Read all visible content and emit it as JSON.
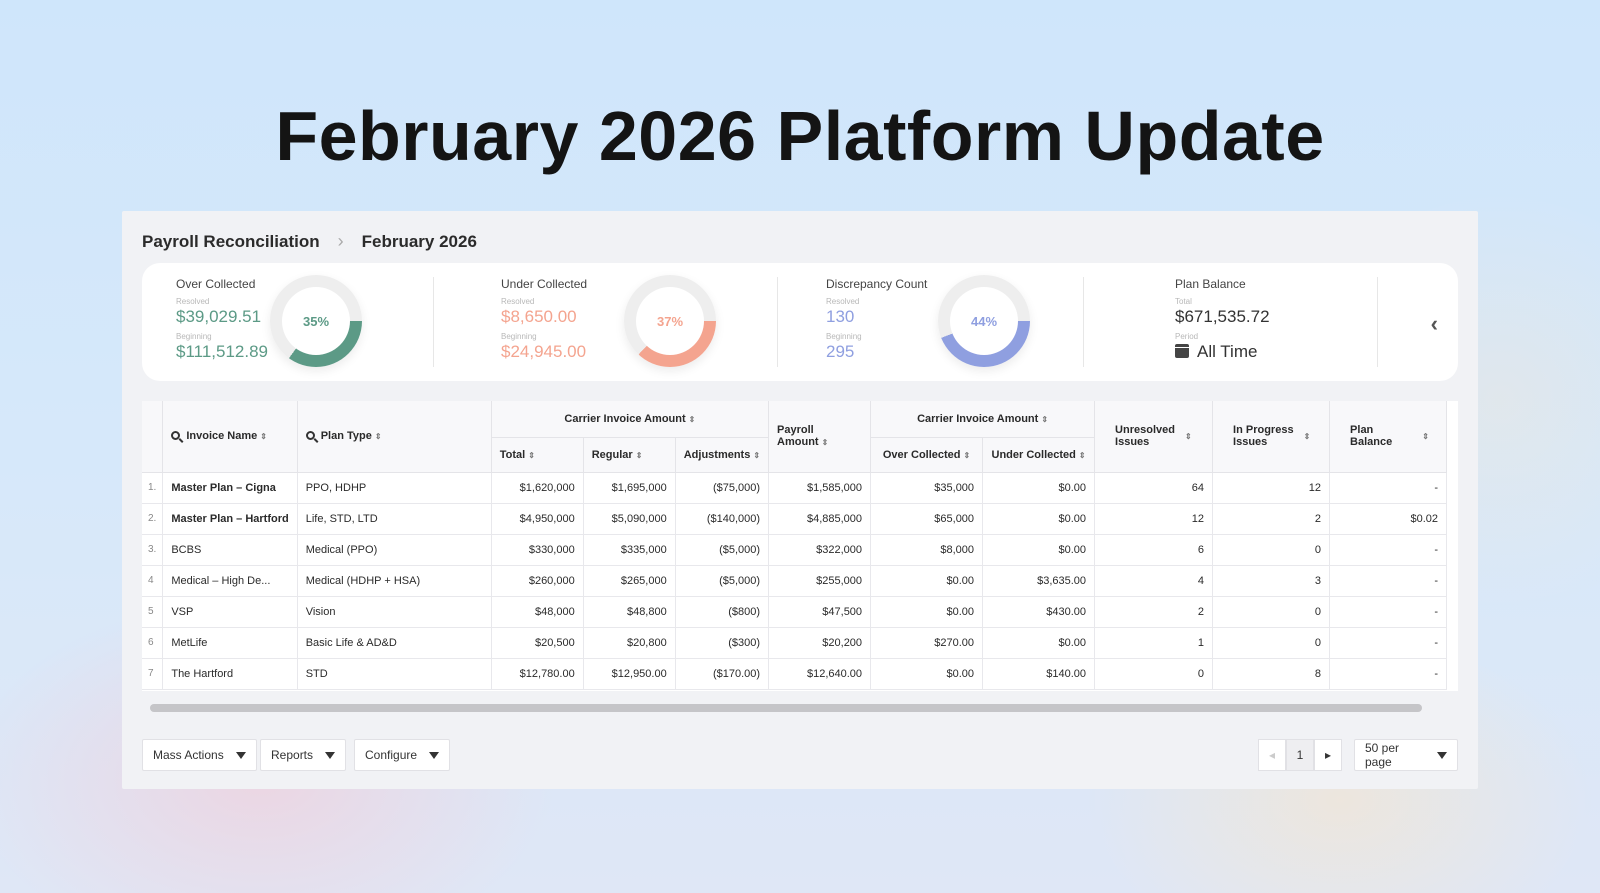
{
  "headline": "February 2026 Platform Update",
  "breadcrumb": {
    "root": "Payroll Reconciliation",
    "current": "February 2026"
  },
  "stats": [
    {
      "label": "Over Collected",
      "sub1": "Resolved",
      "val1": "$39,029.51",
      "sub2": "Beginning",
      "val2": "$111,512.89",
      "percent_text": "35%",
      "percent": 35,
      "color": "#5c9a86"
    },
    {
      "label": "Under Collected",
      "sub1": "Resolved",
      "val1": "$8,650.00",
      "sub2": "Beginning",
      "val2": "$24,945.00",
      "percent_text": "37%",
      "percent": 37,
      "color": "#f4a48f"
    },
    {
      "label": "Discrepancy Count",
      "sub1": "Resolved",
      "val1": "130",
      "sub2": "Beginning",
      "val2": "295",
      "percent_text": "44%",
      "percent": 44,
      "color": "#8f9fe0"
    },
    {
      "label": "Plan Balance",
      "sub1": "Total",
      "val1": "$671,535.72",
      "sub2": "Period",
      "val2": "All Time"
    }
  ],
  "table": {
    "headers": {
      "invoice_name": "Invoice Name",
      "plan_type": "Plan Type",
      "carrier_group": "Carrier Invoice Amount",
      "total": "Total",
      "regular": "Regular",
      "adjustments": "Adjustments",
      "payroll_amount": "Payroll Amount",
      "carrier_group2": "Carrier Invoice Amount",
      "over_collected": "Over Collected",
      "under_collected": "Under Collected",
      "unresolved_l1": "Unresolved",
      "unresolved_l2": "Issues",
      "inprogress_l1": "In Progress",
      "inprogress_l2": "Issues",
      "balance_l1": "Plan",
      "balance_l2": "Balance"
    },
    "rows": [
      {
        "idx": "1.",
        "name": "Master Plan – Cigna",
        "bold": true,
        "plan": "PPO, HDHP",
        "total": "$1,620,000",
        "regular": "$1,695,000",
        "adj": "($75,000)",
        "payroll": "$1,585,000",
        "over": "$35,000",
        "under": "$0.00",
        "unresolved": "64",
        "inprogress": "12",
        "balance": "-"
      },
      {
        "idx": "2.",
        "name": "Master Plan – Hartford",
        "bold": true,
        "plan": "Life, STD, LTD",
        "total": "$4,950,000",
        "regular": "$5,090,000",
        "adj": "($140,000)",
        "payroll": "$4,885,000",
        "over": "$65,000",
        "under": "$0.00",
        "unresolved": "12",
        "inprogress": "2",
        "balance": "$0.02"
      },
      {
        "idx": "3.",
        "name": "BCBS",
        "bold": false,
        "plan": "Medical (PPO)",
        "total": "$330,000",
        "regular": "$335,000",
        "adj": "($5,000)",
        "payroll": "$322,000",
        "over": "$8,000",
        "under": "$0.00",
        "unresolved": "6",
        "inprogress": "0",
        "balance": "-"
      },
      {
        "idx": "4",
        "name": "Medical – High De...",
        "bold": false,
        "plan": "Medical (HDHP + HSA)",
        "total": "$260,000",
        "regular": "$265,000",
        "adj": "($5,000)",
        "payroll": "$255,000",
        "over": "$0.00",
        "under": "$3,635.00",
        "unresolved": "4",
        "inprogress": "3",
        "balance": "-"
      },
      {
        "idx": "5",
        "name": "VSP",
        "bold": false,
        "plan": "Vision",
        "total": "$48,000",
        "regular": "$48,800",
        "adj": "($800)",
        "payroll": "$47,500",
        "over": "$0.00",
        "under": "$430.00",
        "unresolved": "2",
        "inprogress": "0",
        "balance": "-"
      },
      {
        "idx": "6",
        "name": "MetLife",
        "bold": false,
        "plan": "Basic Life & AD&D",
        "total": "$20,500",
        "regular": "$20,800",
        "adj": "($300)",
        "payroll": "$20,200",
        "over": "$270.00",
        "under": "$0.00",
        "unresolved": "1",
        "inprogress": "0",
        "balance": "-"
      },
      {
        "idx": "7",
        "name": "The Hartford",
        "bold": false,
        "plan": "STD",
        "total": "$12,780.00",
        "regular": "$12,950.00",
        "adj": "($170.00)",
        "payroll": "$12,640.00",
        "over": "$0.00",
        "under": "$140.00",
        "unresolved": "0",
        "inprogress": "8",
        "balance": "-"
      }
    ]
  },
  "footer": {
    "mass_actions": "Mass Actions",
    "reports": "Reports",
    "configure": "Configure",
    "page": "1",
    "per_page": "50 per page"
  },
  "icons": [
    "search-icon",
    "sort-icon",
    "chevron-right-icon",
    "chevron-left-icon",
    "calendar-icon",
    "caret-down-icon"
  ]
}
